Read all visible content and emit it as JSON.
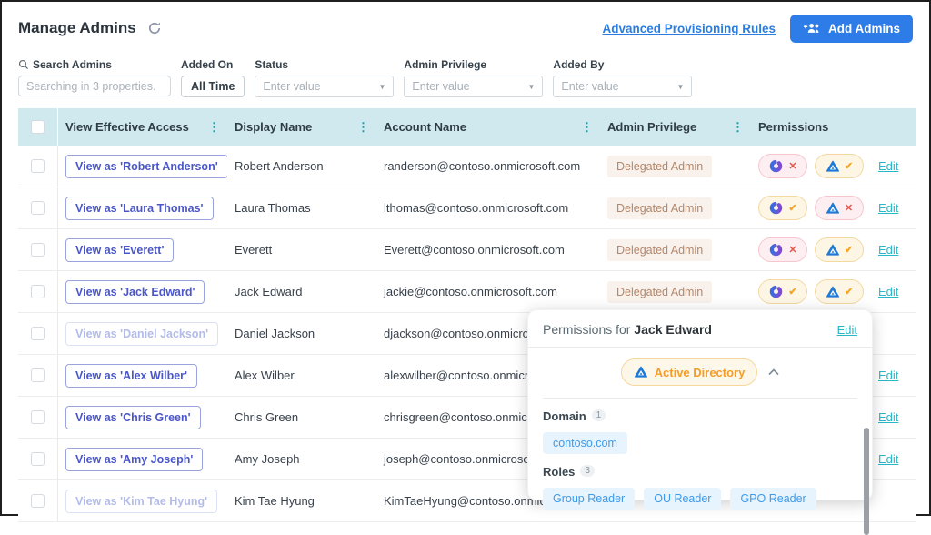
{
  "header": {
    "title": "Manage Admins",
    "advanced_link": "Advanced Provisioning Rules",
    "add_button": "Add Admins"
  },
  "filters": {
    "search": {
      "label": "Search Admins",
      "placeholder": "Searching in 3 properties."
    },
    "added_on": {
      "label": "Added On",
      "value": "All Time"
    },
    "status": {
      "label": "Status",
      "placeholder": "Enter value"
    },
    "admin_privilege": {
      "label": "Admin Privilege",
      "placeholder": "Enter value"
    },
    "added_by": {
      "label": "Added By",
      "placeholder": "Enter value"
    }
  },
  "table": {
    "columns": [
      "View Effective Access",
      "Display Name",
      "Account Name",
      "Admin Privilege",
      "Permissions"
    ],
    "edit_label": "Edit",
    "rows": [
      {
        "view_as": "View as 'Robert Anderson'",
        "disabled": false,
        "display_name": "Robert Anderson",
        "account_name": "randerson@contoso.onmicrosoft.com",
        "privilege": "Delegated Admin",
        "perms": [
          {
            "icon": "m365-icon",
            "status": "denied"
          },
          {
            "icon": "ad-icon",
            "status": "granted"
          }
        ],
        "show_edit": true
      },
      {
        "view_as": "View as 'Laura Thomas'",
        "disabled": false,
        "display_name": "Laura Thomas",
        "account_name": "lthomas@contoso.onmicrosoft.com",
        "privilege": "Delegated Admin",
        "perms": [
          {
            "icon": "m365-icon",
            "status": "granted"
          },
          {
            "icon": "ad-icon",
            "status": "denied"
          }
        ],
        "show_edit": true
      },
      {
        "view_as": "View as 'Everett'",
        "disabled": false,
        "display_name": "Everett",
        "account_name": "Everett@contoso.onmicrosoft.com",
        "privilege": "Delegated Admin",
        "perms": [
          {
            "icon": "m365-icon",
            "status": "denied"
          },
          {
            "icon": "ad-icon",
            "status": "granted"
          }
        ],
        "show_edit": true
      },
      {
        "view_as": "View as 'Jack Edward'",
        "disabled": false,
        "display_name": "Jack Edward",
        "account_name": "jackie@contoso.onmicrosoft.com",
        "privilege": "Delegated Admin",
        "perms": [
          {
            "icon": "m365-icon",
            "status": "granted"
          },
          {
            "icon": "ad-icon",
            "status": "granted"
          }
        ],
        "show_edit": true
      },
      {
        "view_as": "View as 'Daniel Jackson'",
        "disabled": true,
        "display_name": "Daniel Jackson",
        "account_name": "djackson@contoso.onmicrosoft.com",
        "privilege": "",
        "perms": [],
        "show_edit": false
      },
      {
        "view_as": "View as 'Alex Wilber'",
        "disabled": false,
        "display_name": "Alex Wilber",
        "account_name": "alexwilber@contoso.onmicrosoft.com",
        "privilege": "",
        "perms": [],
        "show_edit": true
      },
      {
        "view_as": "View as 'Chris Green'",
        "disabled": false,
        "display_name": "Chris Green",
        "account_name": "chrisgreen@contoso.onmicrosoft.com",
        "privilege": "",
        "perms": [],
        "show_edit": true
      },
      {
        "view_as": "View as 'Amy Joseph'",
        "disabled": false,
        "display_name": "Amy Joseph",
        "account_name": "joseph@contoso.onmicrosoft.com",
        "privilege": "",
        "perms": [],
        "show_edit": true
      },
      {
        "view_as": "View as 'Kim Tae Hyung'",
        "disabled": true,
        "display_name": "Kim Tae Hyung",
        "account_name": "KimTaeHyung@contoso.onmicrosoft.com",
        "privilege": "",
        "perms": [],
        "show_edit": false
      }
    ]
  },
  "popup": {
    "title_prefix": "Permissions for ",
    "subject": "Jack Edward",
    "edit_label": "Edit",
    "service": {
      "label": "Active Directory",
      "icon": "ad-icon"
    },
    "sections": [
      {
        "label": "Domain",
        "count": "1",
        "tags": [
          "contoso.com"
        ]
      },
      {
        "label": "Roles",
        "count": "3",
        "tags": [
          "Group Reader",
          "OU Reader",
          "GPO Reader"
        ]
      }
    ]
  },
  "colors": {
    "accent_blue": "#2e7ce8",
    "teal_link": "#2ab7c8",
    "table_header_bg": "#cfe9ef",
    "privilege_badge_text": "#b5876a",
    "denied_red": "#e8554a",
    "granted_orange": "#f5a623",
    "tag_blue": "#3d9be9",
    "active_directory_orange": "#f59d27"
  }
}
